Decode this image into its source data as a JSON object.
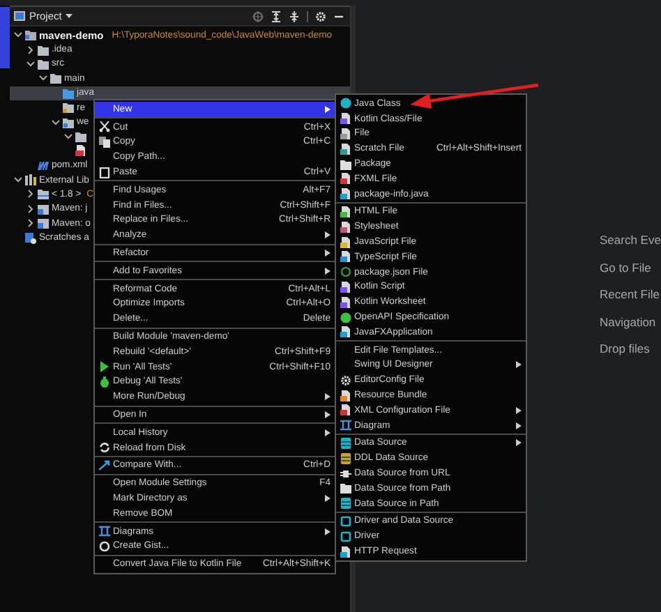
{
  "project_panel": {
    "title": "Project"
  },
  "tree": [
    {
      "label": "maven-demo",
      "path": "H:\\TyporaNotes\\sound_code\\JavaWeb\\maven-demo",
      "kind": "module",
      "expanded": true,
      "selected": false,
      "children": [
        {
          "label": ".idea",
          "kind": "folder",
          "expanded": false,
          "selected": false
        },
        {
          "label": "src",
          "kind": "folder",
          "expanded": true,
          "selected": false,
          "children": [
            {
              "label": "main",
              "kind": "folder",
              "expanded": true,
              "selected": false,
              "children": [
                {
                  "label": "java",
                  "kind": "source",
                  "selected": true
                },
                {
                  "label": "re",
                  "kind": "resources",
                  "selected": false
                },
                {
                  "label": "we",
                  "kind": "webfolder",
                  "expanded": true,
                  "selected": false,
                  "children": [
                    {
                      "kind": "folder",
                      "expanded": true,
                      "selected": false
                    },
                    {
                      "kind": "jsp",
                      "selected": false
                    }
                  ]
                }
              ]
            }
          ]
        },
        {
          "label": "pom.xml",
          "kind": "maven",
          "selected": false
        }
      ]
    },
    {
      "label": "External Lib",
      "kind": "library",
      "expanded": true,
      "selected": false,
      "children": [
        {
          "label": "< 1.8 >",
          "detail": "C",
          "kind": "jdk",
          "expanded": false,
          "selected": false
        },
        {
          "label": "Maven: j",
          "kind": "jar",
          "expanded": false,
          "selected": false
        },
        {
          "label": "Maven: o",
          "kind": "jar",
          "expanded": false,
          "selected": false
        }
      ]
    },
    {
      "label": "Scratches a",
      "kind": "scratches",
      "selected": false
    }
  ],
  "context_menu": {
    "items": [
      {
        "kind": "item",
        "label": "New",
        "has_submenu": true,
        "selected": true
      },
      {
        "kind": "separator"
      },
      {
        "kind": "item",
        "label": "Cut",
        "shortcut": "Ctrl+X",
        "has_submenu": false,
        "selected": false
      },
      {
        "kind": "item",
        "label": "Copy",
        "shortcut": "Ctrl+C",
        "has_submenu": false,
        "selected": false
      },
      {
        "kind": "item",
        "label": "Copy Path...",
        "has_submenu": false,
        "selected": false
      },
      {
        "kind": "item",
        "label": "Paste",
        "shortcut": "Ctrl+V",
        "has_submenu": false,
        "selected": false
      },
      {
        "kind": "separator"
      },
      {
        "kind": "item",
        "label": "Find Usages",
        "shortcut": "Alt+F7",
        "has_submenu": false,
        "selected": false
      },
      {
        "kind": "item",
        "label": "Find in Files...",
        "shortcut": "Ctrl+Shift+F",
        "has_submenu": false,
        "selected": false
      },
      {
        "kind": "item",
        "label": "Replace in Files...",
        "shortcut": "Ctrl+Shift+R",
        "has_submenu": false,
        "selected": false
      },
      {
        "kind": "item",
        "label": "Analyze",
        "has_submenu": true,
        "selected": false
      },
      {
        "kind": "separator"
      },
      {
        "kind": "item",
        "label": "Refactor",
        "has_submenu": true,
        "selected": false
      },
      {
        "kind": "separator"
      },
      {
        "kind": "item",
        "label": "Add to Favorites",
        "has_submenu": true,
        "selected": false
      },
      {
        "kind": "separator"
      },
      {
        "kind": "item",
        "label": "Reformat Code",
        "shortcut": "Ctrl+Alt+L",
        "has_submenu": false,
        "selected": false
      },
      {
        "kind": "item",
        "label": "Optimize Imports",
        "shortcut": "Ctrl+Alt+O",
        "has_submenu": false,
        "selected": false
      },
      {
        "kind": "item",
        "label": "Delete...",
        "shortcut": "Delete",
        "has_submenu": false,
        "selected": false
      },
      {
        "kind": "separator"
      },
      {
        "kind": "item",
        "label": "Build Module 'maven-demo'",
        "has_submenu": false,
        "selected": false
      },
      {
        "kind": "item",
        "label": "Rebuild '<default>'",
        "shortcut": "Ctrl+Shift+F9",
        "has_submenu": false,
        "selected": false
      },
      {
        "kind": "item",
        "label": "Run 'All Tests'",
        "shortcut": "Ctrl+Shift+F10",
        "has_submenu": false,
        "selected": false
      },
      {
        "kind": "item",
        "label": "Debug 'All Tests'",
        "has_submenu": false,
        "selected": false
      },
      {
        "kind": "item",
        "label": "More Run/Debug",
        "has_submenu": true,
        "selected": false
      },
      {
        "kind": "separator"
      },
      {
        "kind": "item",
        "label": "Open In",
        "has_submenu": true,
        "selected": false
      },
      {
        "kind": "separator"
      },
      {
        "kind": "item",
        "label": "Local History",
        "has_submenu": true,
        "selected": false
      },
      {
        "kind": "item",
        "label": "Reload from Disk",
        "has_submenu": false,
        "selected": false
      },
      {
        "kind": "separator"
      },
      {
        "kind": "item",
        "label": "Compare With...",
        "shortcut": "Ctrl+D",
        "has_submenu": false,
        "selected": false
      },
      {
        "kind": "separator"
      },
      {
        "kind": "item",
        "label": "Open Module Settings",
        "shortcut": "F4",
        "has_submenu": false,
        "selected": false
      },
      {
        "kind": "item",
        "label": "Mark Directory as",
        "has_submenu": true,
        "selected": false
      },
      {
        "kind": "item",
        "label": "Remove BOM",
        "has_submenu": false,
        "selected": false
      },
      {
        "kind": "separator"
      },
      {
        "kind": "item",
        "label": "Diagrams",
        "has_submenu": true,
        "selected": false
      },
      {
        "kind": "item",
        "label": "Create Gist...",
        "has_submenu": false,
        "selected": false
      },
      {
        "kind": "separator"
      },
      {
        "kind": "item",
        "label": "Convert Java File to Kotlin File",
        "shortcut": "Ctrl+Alt+Shift+K",
        "has_submenu": false,
        "selected": false
      }
    ]
  },
  "new_submenu": {
    "items": [
      {
        "kind": "item",
        "label": "Java Class",
        "has_submenu": false,
        "selected": false
      },
      {
        "kind": "item",
        "label": "Kotlin Class/File",
        "has_submenu": false,
        "selected": false
      },
      {
        "kind": "item",
        "label": "File",
        "has_submenu": false,
        "selected": false
      },
      {
        "kind": "item",
        "label": "Scratch File",
        "shortcut": "Ctrl+Alt+Shift+Insert",
        "has_submenu": false,
        "selected": false
      },
      {
        "kind": "item",
        "label": "Package",
        "has_submenu": false,
        "selected": false
      },
      {
        "kind": "item",
        "label": "FXML File",
        "has_submenu": false,
        "selected": false
      },
      {
        "kind": "item",
        "label": "package-info.java",
        "has_submenu": false,
        "selected": false
      },
      {
        "kind": "separator"
      },
      {
        "kind": "item",
        "label": "HTML File",
        "has_submenu": false,
        "selected": false
      },
      {
        "kind": "item",
        "label": "Stylesheet",
        "has_submenu": false,
        "selected": false
      },
      {
        "kind": "item",
        "label": "JavaScript File",
        "has_submenu": false,
        "selected": false
      },
      {
        "kind": "item",
        "label": "TypeScript File",
        "has_submenu": false,
        "selected": false
      },
      {
        "kind": "item",
        "label": "package.json File",
        "has_submenu": false,
        "selected": false
      },
      {
        "kind": "item",
        "label": "Kotlin Script",
        "has_submenu": false,
        "selected": false
      },
      {
        "kind": "item",
        "label": "Kotlin Worksheet",
        "has_submenu": false,
        "selected": false
      },
      {
        "kind": "item",
        "label": "OpenAPI Specification",
        "has_submenu": false,
        "selected": false
      },
      {
        "kind": "item",
        "label": "JavaFXApplication",
        "has_submenu": false,
        "selected": false
      },
      {
        "kind": "separator"
      },
      {
        "kind": "item",
        "label": "Edit File Templates...",
        "has_submenu": false,
        "selected": false
      },
      {
        "kind": "item",
        "label": "Swing UI Designer",
        "has_submenu": true,
        "selected": false
      },
      {
        "kind": "item",
        "label": "EditorConfig File",
        "has_submenu": false,
        "selected": false
      },
      {
        "kind": "item",
        "label": "Resource Bundle",
        "has_submenu": false,
        "selected": false
      },
      {
        "kind": "item",
        "label": "XML Configuration File",
        "has_submenu": true,
        "selected": false
      },
      {
        "kind": "item",
        "label": "Diagram",
        "has_submenu": true,
        "selected": false
      },
      {
        "kind": "separator"
      },
      {
        "kind": "item",
        "label": "Data Source",
        "has_submenu": true,
        "selected": false
      },
      {
        "kind": "item",
        "label": "DDL Data Source",
        "has_submenu": false,
        "selected": false
      },
      {
        "kind": "item",
        "label": "Data Source from URL",
        "has_submenu": false,
        "selected": false
      },
      {
        "kind": "item",
        "label": "Data Source from Path",
        "has_submenu": false,
        "selected": false
      },
      {
        "kind": "item",
        "label": "Data Source in Path",
        "has_submenu": false,
        "selected": false
      },
      {
        "kind": "separator"
      },
      {
        "kind": "item",
        "label": "Driver and Data Source",
        "has_submenu": false,
        "selected": false
      },
      {
        "kind": "item",
        "label": "Driver",
        "has_submenu": false,
        "selected": false
      },
      {
        "kind": "item",
        "label": "HTTP Request",
        "has_submenu": false,
        "selected": false
      }
    ]
  },
  "editor_hints": [
    "Search Eve",
    "Go to File",
    "Recent File",
    "Navigation",
    "Drop files"
  ]
}
